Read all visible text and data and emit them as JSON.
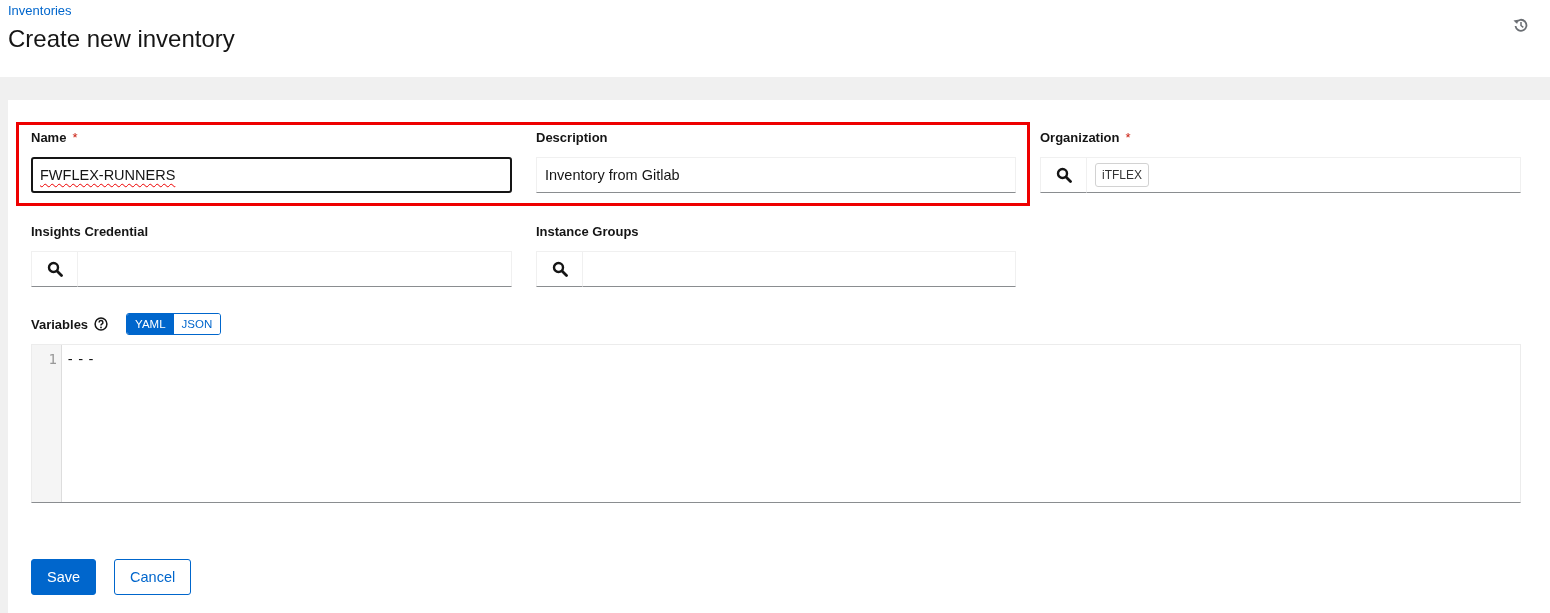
{
  "breadcrumb": "Inventories",
  "title": "Create new inventory",
  "fields": [
    {
      "kind": "text",
      "label": "Name",
      "required_mark": "*",
      "value": "FWFLEX-RUNNERS",
      "focused": true,
      "misspelled": true,
      "highlighted": true
    },
    {
      "kind": "text",
      "label": "Description",
      "value": "Inventory from Gitlab",
      "focused": false,
      "misspelled": false,
      "highlighted": true
    },
    {
      "kind": "lookup",
      "label": "Organization",
      "required_mark": "*",
      "chips": [
        "iTFLEX"
      ],
      "highlighted": false
    },
    {
      "kind": "lookup",
      "label": "Insights Credential",
      "highlighted": false
    },
    {
      "kind": "lookup",
      "label": "Instance Groups",
      "highlighted": false
    }
  ],
  "variables": {
    "label": "Variables",
    "modes": [
      {
        "label": "YAML",
        "selected": true
      },
      {
        "label": "JSON",
        "selected": false
      }
    ],
    "lines": [
      {
        "number": "1",
        "text": "---"
      }
    ]
  },
  "buttons": [
    {
      "label": "Save",
      "kind": "primary"
    },
    {
      "label": "Cancel",
      "kind": "secondary"
    }
  ]
}
